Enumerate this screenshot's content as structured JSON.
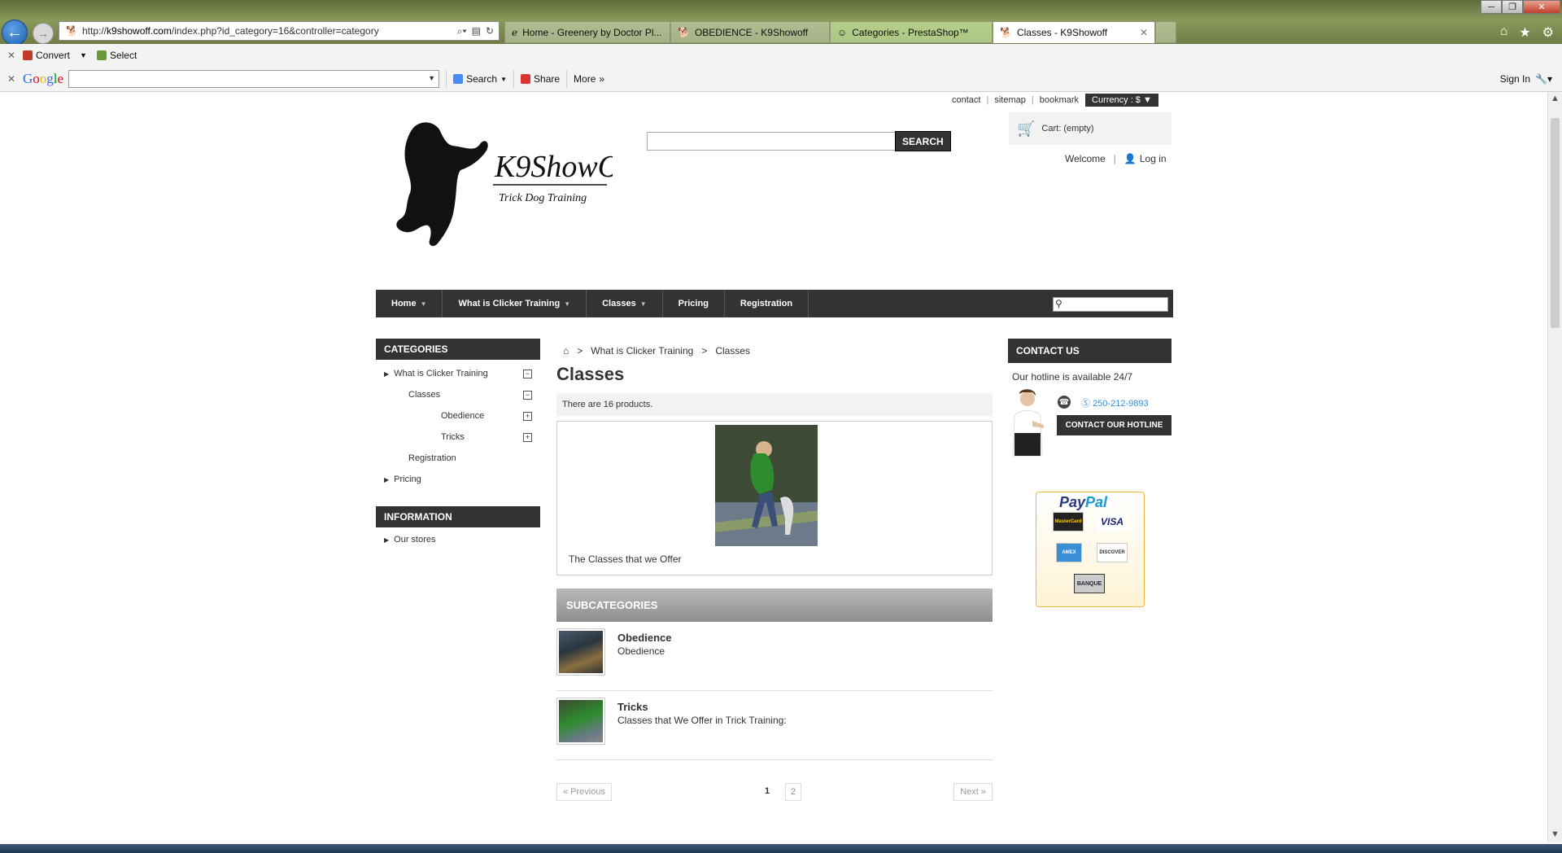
{
  "browser": {
    "url_prefix": "http://",
    "url_domain": "k9showoff.com",
    "url_path": "/index.php?id_category=16&controller=category",
    "tabs": [
      {
        "label": "Home - Greenery by Doctor Pl..."
      },
      {
        "label": "OBEDIENCE - K9Showoff"
      },
      {
        "label": "Categories - PrestaShop™"
      },
      {
        "label": "Classes - K9Showoff"
      }
    ],
    "command_bar": {
      "convert": "Convert",
      "select": "Select"
    },
    "google_bar": {
      "search": "Search",
      "share": "Share",
      "more": "More",
      "sign_in": "Sign In"
    }
  },
  "header": {
    "links": [
      "contact",
      "sitemap",
      "bookmark"
    ],
    "currency": "Currency : $",
    "search_button": "SEARCH",
    "cart": "Cart: (empty)",
    "welcome": "Welcome",
    "login": "Log in"
  },
  "menu": {
    "items": [
      "Home",
      "What is Clicker Training",
      "Classes",
      "Pricing",
      "Registration"
    ]
  },
  "categories": {
    "title": "CATEGORIES",
    "items": [
      "What is Clicker Training",
      "Classes",
      "Obedience",
      "Tricks",
      "Registration",
      "Pricing"
    ],
    "information_title": "INFORMATION",
    "information_items": [
      "Our stores"
    ]
  },
  "main": {
    "breadcrumb": [
      "What is Clicker Training",
      "Classes"
    ],
    "breadcrumb_sep": ">",
    "title": "Classes",
    "count_text": "There are 16 products.",
    "description": "The Classes that we Offer",
    "subcategories_title": "SUBCATEGORIES",
    "subcategories": [
      {
        "name": "Obedience",
        "desc": "Obedience"
      },
      {
        "name": "Tricks",
        "desc": "Classes that We Offer in Trick Training:"
      }
    ],
    "pager": {
      "prev": "« Previous",
      "next": "Next »",
      "pages": [
        "1",
        "2"
      ]
    }
  },
  "contact": {
    "title": "CONTACT US",
    "hotline_text": "Our hotline is available 24/7",
    "phone": "250-212-9893",
    "button": "CONTACT OUR HOTLINE"
  },
  "paypal": {
    "logo_a": "Pay",
    "logo_b": "Pal",
    "cards": [
      "MasterCard",
      "VISA",
      "AMEX",
      "DISCOVER",
      "BANQUE"
    ]
  }
}
